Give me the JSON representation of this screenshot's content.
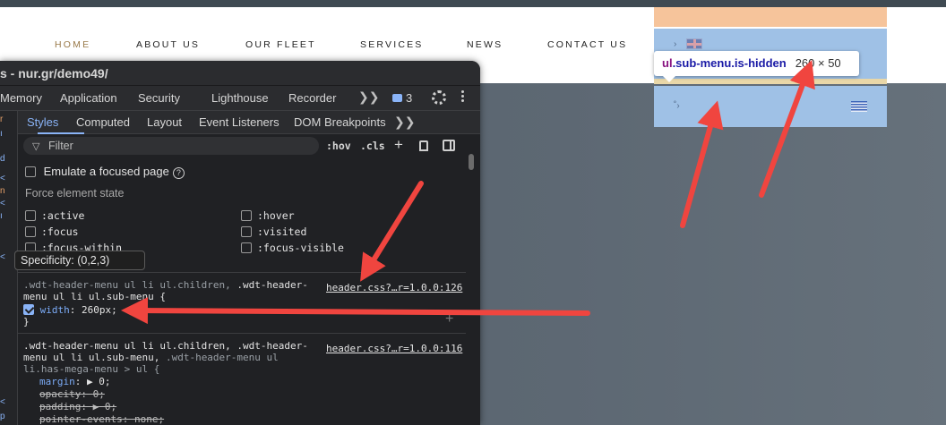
{
  "site": {
    "nav": [
      "HOME",
      "ABOUT US",
      "OUR FLEET",
      "SERVICES",
      "NEWS",
      "CONTACT US"
    ]
  },
  "inspector_tooltip": {
    "tag": "ul",
    "classes": ".sub-menu.is-hidden",
    "size": "260 × 50"
  },
  "devtools": {
    "title": "s - nur.gr/demo49/",
    "tabs": [
      "Memory",
      "Application",
      "Security",
      "Lighthouse",
      "Recorder"
    ],
    "more": "❯❯",
    "issues_count": "3",
    "subtabs": [
      "Styles",
      "Computed",
      "Layout",
      "Event Listeners",
      "DOM Breakpoints"
    ],
    "filter_placeholder": "Filter",
    "hov": ":hov",
    "cls": ".cls",
    "emulate_focus": "Emulate a focused page",
    "force_state": "Force element state",
    "pseudo_states": [
      ":active",
      ":hover",
      ":focus",
      ":visited",
      ":focus-within",
      ":focus-visible"
    ],
    "specificity": "Specificity: (0,2,3)",
    "rule1": {
      "selector_l1_dim": ".wdt-header-menu ul li ul.children, ",
      "selector_l1_main": ".wdt-header-",
      "selector_l2": "menu ul li ul.sub-menu {",
      "source": "header.css?…r=1.0.0:126",
      "prop": "width",
      "value": "260px;",
      "close": "}"
    },
    "rule2": {
      "selector_l1_main": ".wdt-header-menu ul li ul.children, .wdt-header-",
      "selector_l2_main": "menu ul li ul.sub-menu, ",
      "selector_l2_dim": ".wdt-header-menu ul",
      "selector_l3": "li.has-mega-menu > ul {",
      "source": "header.css?…r=1.0.0:116",
      "props": [
        {
          "name": "margin",
          "value": "▶ 0;",
          "strike": false
        },
        {
          "name": "opacity",
          "value": "0;",
          "strike": true
        },
        {
          "name": "padding",
          "value": "▶ 0;",
          "strike": true
        },
        {
          "name": "pointer-events",
          "value": "none;",
          "strike": true
        }
      ]
    }
  },
  "colors": {
    "arrow": "#f0453f",
    "highlight_blue": "#9fc1e6",
    "highlight_peach": "#f6c49b"
  }
}
